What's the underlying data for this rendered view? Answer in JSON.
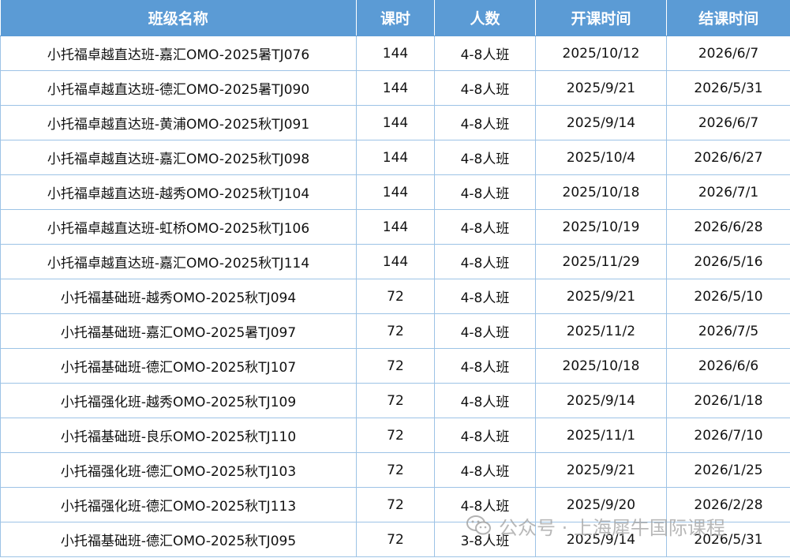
{
  "table": {
    "headers": [
      "班级名称",
      "课时",
      "人数",
      "开课时间",
      "结课时间"
    ],
    "rows": [
      [
        "小托福卓越直达班-嘉汇OMO-2025暑TJ076",
        "144",
        "4-8人班",
        "2025/10/12",
        "2026/6/7"
      ],
      [
        "小托福卓越直达班-德汇OMO-2025暑TJ090",
        "144",
        "4-8人班",
        "2025/9/21",
        "2026/5/31"
      ],
      [
        "小托福卓越直达班-黄浦OMO-2025秋TJ091",
        "144",
        "4-8人班",
        "2025/9/14",
        "2026/6/7"
      ],
      [
        "小托福卓越直达班-嘉汇OMO-2025秋TJ098",
        "144",
        "4-8人班",
        "2025/10/4",
        "2026/6/27"
      ],
      [
        "小托福卓越直达班-越秀OMO-2025秋TJ104",
        "144",
        "4-8人班",
        "2025/10/18",
        "2026/7/1"
      ],
      [
        "小托福卓越直达班-虹桥OMO-2025秋TJ106",
        "144",
        "4-8人班",
        "2025/10/19",
        "2026/6/28"
      ],
      [
        "小托福卓越直达班-嘉汇OMO-2025秋TJ114",
        "144",
        "4-8人班",
        "2025/11/29",
        "2026/5/16"
      ],
      [
        "小托福基础班-越秀OMO-2025秋TJ094",
        "72",
        "4-8人班",
        "2025/9/21",
        "2026/5/10"
      ],
      [
        "小托福基础班-嘉汇OMO-2025暑TJ097",
        "72",
        "4-8人班",
        "2025/11/2",
        "2026/7/5"
      ],
      [
        "小托福基础班-德汇OMO-2025秋TJ107",
        "72",
        "4-8人班",
        "2025/10/18",
        "2026/6/6"
      ],
      [
        "小托福强化班-越秀OMO-2025秋TJ109",
        "72",
        "4-8人班",
        "2025/9/14",
        "2026/1/18"
      ],
      [
        "小托福基础班-良乐OMO-2025秋TJ110",
        "72",
        "4-8人班",
        "2025/11/1",
        "2026/7/10"
      ],
      [
        "小托福强化班-德汇OMO-2025秋TJ103",
        "72",
        "4-8人班",
        "2025/9/21",
        "2026/1/25"
      ],
      [
        "小托福强化班-德汇OMO-2025秋TJ113",
        "72",
        "4-8人班",
        "2025/9/20",
        "2026/2/28"
      ],
      [
        "小托福基础班-德汇OMO-2025秋TJ095",
        "72",
        "3-8人班",
        "2025/9/14",
        "2026/5/31"
      ]
    ]
  },
  "watermark": {
    "icon": "wechat-icon",
    "text": "公众号 · 上海犀牛国际课程"
  },
  "colors": {
    "header_bg": "#5b9bd5",
    "header_text": "#ffffff",
    "grid_line": "#9dc3e6"
  }
}
